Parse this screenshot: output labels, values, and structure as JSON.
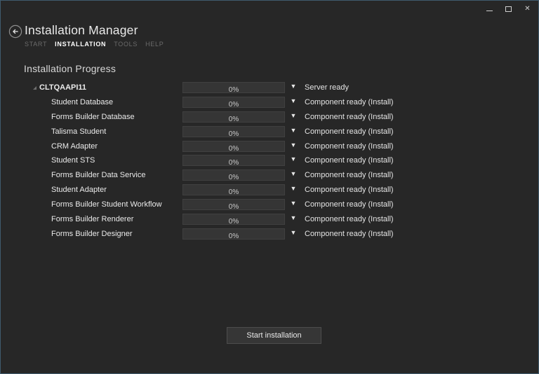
{
  "colors": {
    "window_bg": "#272727",
    "window_border": "#3f5b6e",
    "bar_bg": "#353535",
    "bar_border": "#404040",
    "control_bg": "#363636",
    "control_border": "#4d4d4d",
    "text_bright": "#efefef",
    "text_dim": "#6b6b6b"
  },
  "icons": {
    "close": "✕",
    "dropdown_arrow": "▼"
  },
  "header": {
    "title": "Installation Manager"
  },
  "nav": {
    "items": [
      {
        "label": "START",
        "active": false
      },
      {
        "label": "INSTALLATION",
        "active": true
      },
      {
        "label": "TOOLS",
        "active": false
      },
      {
        "label": "HELP",
        "active": false
      }
    ]
  },
  "main": {
    "heading": "Installation Progress"
  },
  "components": [
    {
      "type": "server",
      "name": "CLTQAAPI11",
      "progress_label": "0%",
      "progress_percent": 0,
      "status": "Server ready"
    },
    {
      "type": "component",
      "name": "Student Database",
      "progress_label": "0%",
      "progress_percent": 0,
      "status": "Component ready (Install)"
    },
    {
      "type": "component",
      "name": "Forms Builder Database",
      "progress_label": "0%",
      "progress_percent": 0,
      "status": "Component ready (Install)"
    },
    {
      "type": "component",
      "name": "Talisma Student",
      "progress_label": "0%",
      "progress_percent": 0,
      "status": "Component ready (Install)"
    },
    {
      "type": "component",
      "name": "CRM Adapter",
      "progress_label": "0%",
      "progress_percent": 0,
      "status": "Component ready (Install)"
    },
    {
      "type": "component",
      "name": "Student STS",
      "progress_label": "0%",
      "progress_percent": 0,
      "status": "Component ready (Install)"
    },
    {
      "type": "component",
      "name": "Forms Builder Data Service",
      "progress_label": "0%",
      "progress_percent": 0,
      "status": "Component ready (Install)"
    },
    {
      "type": "component",
      "name": "Student Adapter",
      "progress_label": "0%",
      "progress_percent": 0,
      "status": "Component ready (Install)"
    },
    {
      "type": "component",
      "name": "Forms Builder Student Workflow",
      "progress_label": "0%",
      "progress_percent": 0,
      "status": "Component ready (Install)"
    },
    {
      "type": "component",
      "name": "Forms Builder Renderer",
      "progress_label": "0%",
      "progress_percent": 0,
      "status": "Component ready (Install)"
    },
    {
      "type": "component",
      "name": "Forms Builder Designer",
      "progress_label": "0%",
      "progress_percent": 0,
      "status": "Component ready (Install)"
    }
  ],
  "footer": {
    "start_button_label": "Start installation"
  }
}
